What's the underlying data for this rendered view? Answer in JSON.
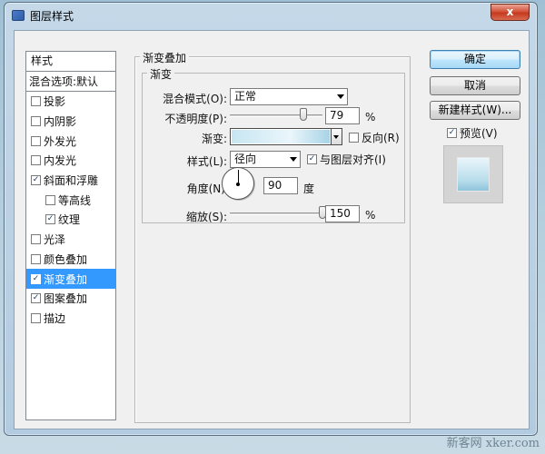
{
  "window": {
    "title": "图层样式",
    "close": "x"
  },
  "style_list": {
    "header": "样式",
    "blend_options": "混合选项:默认",
    "items": [
      {
        "label": "投影",
        "checked": false,
        "indent": false,
        "active": false
      },
      {
        "label": "内阴影",
        "checked": false,
        "indent": false,
        "active": false
      },
      {
        "label": "外发光",
        "checked": false,
        "indent": false,
        "active": false
      },
      {
        "label": "内发光",
        "checked": false,
        "indent": false,
        "active": false
      },
      {
        "label": "斜面和浮雕",
        "checked": true,
        "indent": false,
        "active": false
      },
      {
        "label": "等高线",
        "checked": false,
        "indent": true,
        "active": false
      },
      {
        "label": "纹理",
        "checked": true,
        "indent": true,
        "active": false
      },
      {
        "label": "光泽",
        "checked": false,
        "indent": false,
        "active": false
      },
      {
        "label": "颜色叠加",
        "checked": false,
        "indent": false,
        "active": false
      },
      {
        "label": "渐变叠加",
        "checked": true,
        "indent": false,
        "active": true
      },
      {
        "label": "图案叠加",
        "checked": true,
        "indent": false,
        "active": false
      },
      {
        "label": "描边",
        "checked": false,
        "indent": false,
        "active": false
      }
    ]
  },
  "panel": {
    "title": "渐变叠加",
    "subtitle": "渐变",
    "blend_mode_label": "混合模式(O):",
    "blend_mode_value": "正常",
    "opacity_label": "不透明度(P):",
    "opacity_value": "79",
    "opacity_unit": "%",
    "opacity_fraction": 0.79,
    "gradient_label": "渐变:",
    "reverse_label": "反向(R)",
    "reverse_checked": false,
    "style_label": "样式(L):",
    "style_value": "径向",
    "align_label": "与图层对齐(I)",
    "align_checked": true,
    "angle_label": "角度(N):",
    "angle_value": "90",
    "angle_unit": "度",
    "scale_label": "缩放(S):",
    "scale_value": "150",
    "scale_unit": "%",
    "scale_fraction": 1.0
  },
  "buttons": {
    "ok": "确定",
    "cancel": "取消",
    "new_style": "新建样式(W)...",
    "preview_label": "预览(V)",
    "preview_checked": true
  },
  "watermark": "新客网 xker.com",
  "check_mark": "✓"
}
